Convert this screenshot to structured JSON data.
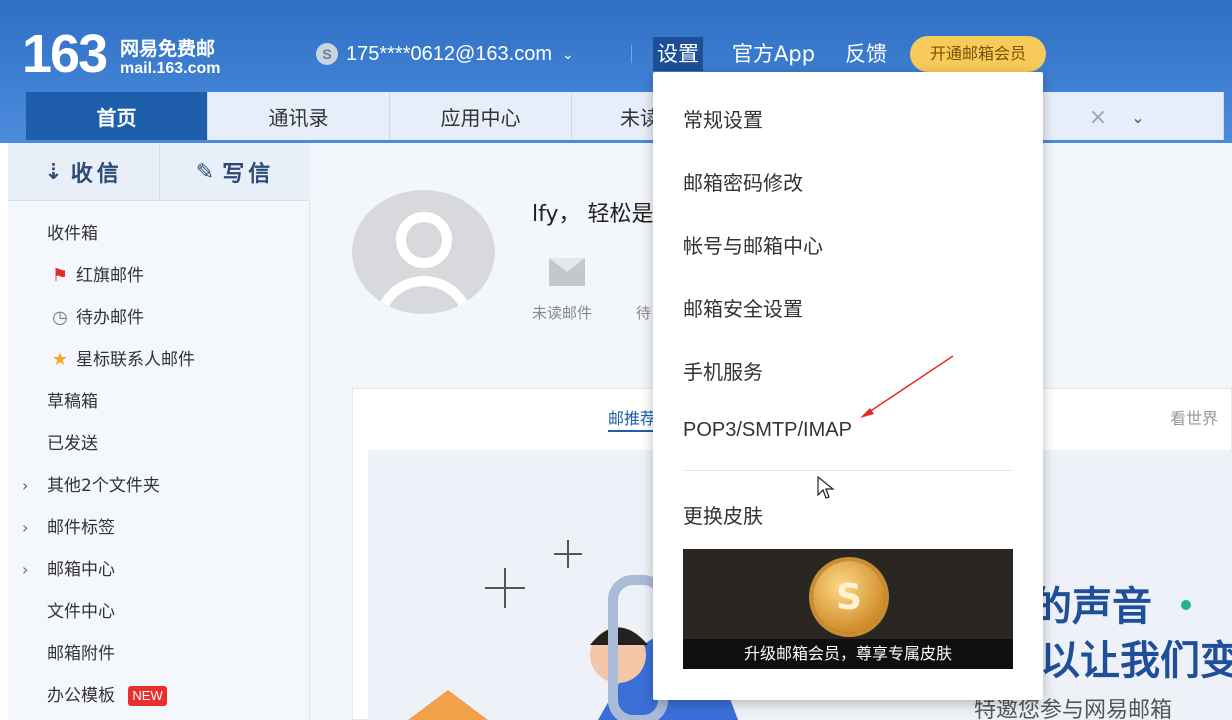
{
  "header": {
    "logo_number": "163",
    "logo_cn": "网易免费邮",
    "logo_url": "mail.163.com",
    "account": "175****0612@163.com",
    "coin_symbol": "S",
    "nav_settings": "设置",
    "nav_app": "官方App",
    "nav_feedback": "反馈",
    "vip_button": "开通邮箱会员"
  },
  "tabs": [
    {
      "label": "首页",
      "active": true
    },
    {
      "label": "通讯录"
    },
    {
      "label": "应用中心"
    },
    {
      "label": "未读"
    }
  ],
  "sidebar": {
    "receive": "收信",
    "compose": "写信",
    "folders": [
      {
        "label": "收件箱"
      },
      {
        "label": "红旗邮件",
        "icon": "red-flag-icon"
      },
      {
        "label": "待办邮件",
        "icon": "clock-icon"
      },
      {
        "label": "星标联系人邮件",
        "icon": "star-icon"
      },
      {
        "label": "草稿箱"
      },
      {
        "label": "已发送"
      },
      {
        "label": "其他2个文件夹",
        "expandable": true
      },
      {
        "label": "邮件标签",
        "expandable": true
      },
      {
        "label": "邮箱中心",
        "expandable": true
      },
      {
        "label": "文件中心"
      },
      {
        "label": "邮箱附件"
      },
      {
        "label": "办公模板",
        "badge": "NEW"
      }
    ]
  },
  "main": {
    "greeting": "lfy， 轻松是",
    "stat_unread": "未读邮件",
    "stat_todo": "待",
    "tab_recommend": "邮推荐",
    "tab_world": "看世界",
    "banner_line1": "的声音",
    "banner_line2": "以让我们变",
    "banner_line3": "特邀您参与网易邮箱"
  },
  "settings_menu": {
    "items": [
      "常规设置",
      "邮箱密码修改",
      "帐号与邮箱中心",
      "邮箱安全设置",
      "手机服务",
      "POP3/SMTP/IMAP"
    ],
    "skin": "更换皮肤",
    "skin_caption": "升级邮箱会员，尊享专属皮肤",
    "medal_symbol": "S"
  },
  "colors": {
    "header_blue": "#3f7fd2",
    "active_tab": "#1e5eaa",
    "vip_gold": "#f6cb5a",
    "annotation_red": "#e32b2b"
  }
}
